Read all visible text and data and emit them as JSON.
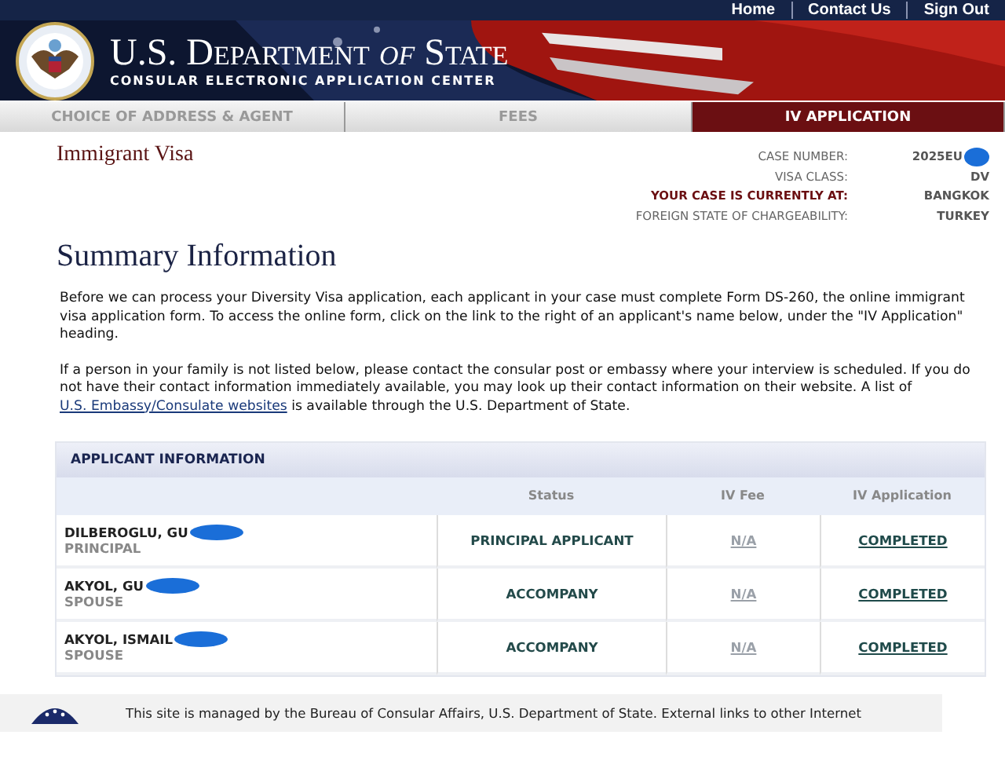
{
  "top_links": [
    "Home",
    "Contact Us",
    "Sign Out"
  ],
  "banner": {
    "title": "U.S. Department *of* State",
    "subtitle": "CONSULAR ELECTRONIC APPLICATION CENTER"
  },
  "tabs": [
    {
      "label": "CHOICE OF ADDRESS & AGENT",
      "selected": false
    },
    {
      "label": "FEES",
      "selected": false
    },
    {
      "label": "IV APPLICATION",
      "selected": true
    }
  ],
  "section_title": "Immigrant Visa",
  "case_info": [
    {
      "label": "CASE NUMBER:",
      "value": "2025EU",
      "emphasis": false,
      "redacted": true
    },
    {
      "label": "VISA CLASS:",
      "value": "DV",
      "emphasis": false,
      "redacted": false
    },
    {
      "label": "YOUR CASE IS CURRENTLY AT:",
      "value": "BANGKOK",
      "emphasis": true,
      "redacted": false
    },
    {
      "label": "FOREIGN STATE OF CHARGEABILITY:",
      "value": "TURKEY",
      "emphasis": false,
      "redacted": false
    }
  ],
  "heading": "Summary Information",
  "paragraphs": [
    {
      "text": "Before we can process your Diversity Visa application, each applicant in your case must complete Form DS-260, the online immigrant visa application form. To access the online form, click on the link to the right of an applicant's name below, under the \"IV Application\" heading."
    },
    {
      "text": "If a person in your family is not listed below, please contact the consular post or embassy where your interview is scheduled. If you do not have their contact information immediately available, you may look up their contact information on their website. A list of ",
      "link": "U.S. Embassy/Consulate websites",
      "after": " is available through the U.S. Department of State."
    }
  ],
  "table": {
    "title": "APPLICANT INFORMATION",
    "columns": [
      "Status",
      "IV Fee",
      "IV Application"
    ],
    "rows": [
      {
        "name": "DILBEROGLU, GU",
        "role": "PRINCIPAL",
        "status": "PRINCIPAL APPLICANT",
        "fee": "N/A",
        "application": "COMPLETED"
      },
      {
        "name": "AKYOL, GU",
        "role": "SPOUSE",
        "status": "ACCOMPANY",
        "fee": "N/A",
        "application": "COMPLETED"
      },
      {
        "name": "AKYOL, ISMAIL",
        "role": "SPOUSE",
        "status": "ACCOMPANY",
        "fee": "N/A",
        "application": "COMPLETED"
      }
    ]
  },
  "footer": "This site is managed by the Bureau of Consular Affairs, U.S. Department of State. External links to other Internet"
}
